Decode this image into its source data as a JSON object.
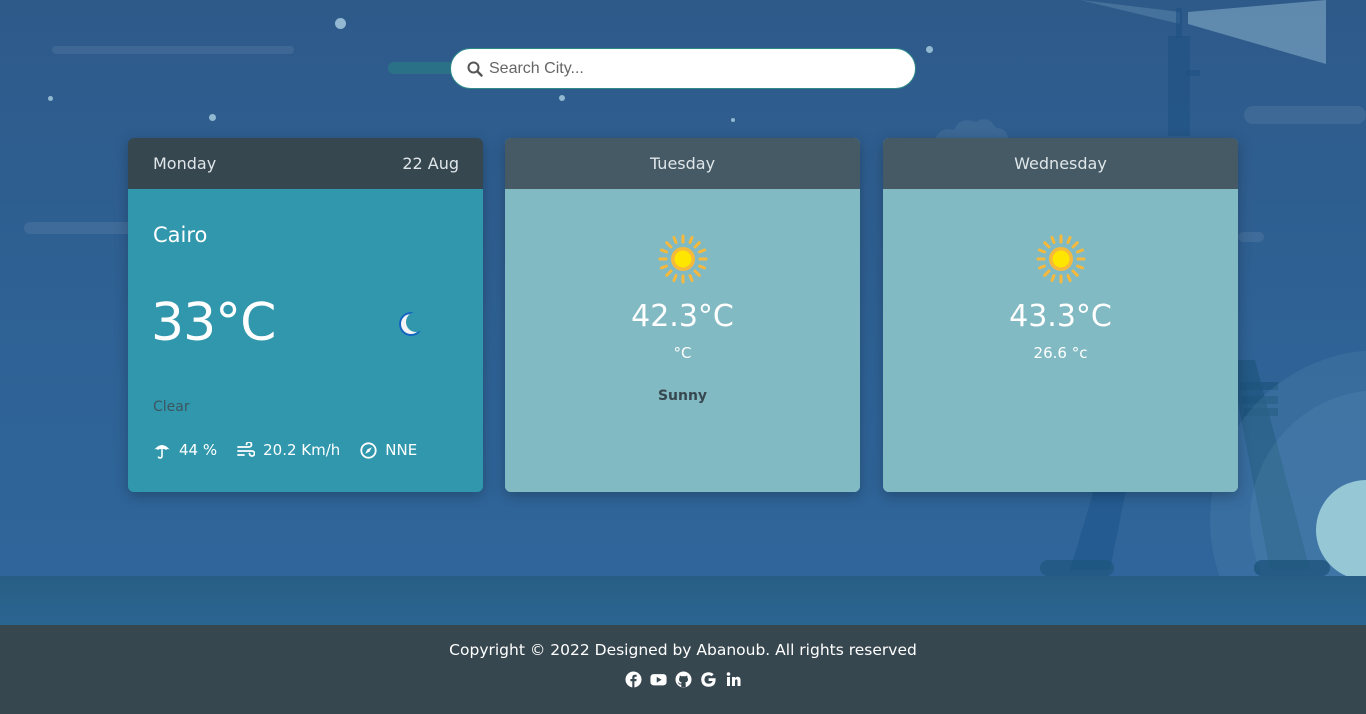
{
  "search": {
    "placeholder": "Search City..."
  },
  "today": {
    "day": "Monday",
    "date": "22 Aug",
    "city": "Cairo",
    "temp": "33°C",
    "condition": "Clear",
    "icon": "moon-icon",
    "humidity": "44 %",
    "wind": "20.2 Km/h",
    "direction": "NNE"
  },
  "forecast": [
    {
      "day": "Tuesday",
      "icon": "sun-icon",
      "max_temp": "42.3°C",
      "min_temp": "°C",
      "description": "Sunny"
    },
    {
      "day": "Wednesday",
      "icon": "sun-icon",
      "max_temp": "43.3°C",
      "min_temp": "26.6 °c",
      "description": ""
    }
  ],
  "footer": {
    "copyright": "Copyright © 2022 Designed by Abanoub. All rights reserved",
    "socials": [
      "facebook-icon",
      "youtube-icon",
      "github-icon",
      "google-icon",
      "linkedin-icon"
    ]
  },
  "colors": {
    "today_card": "#3097ad",
    "forecast_card": "#82bac3",
    "card_header_dark": "#36474f",
    "card_header": "#455a64",
    "footer": "#37474f"
  }
}
